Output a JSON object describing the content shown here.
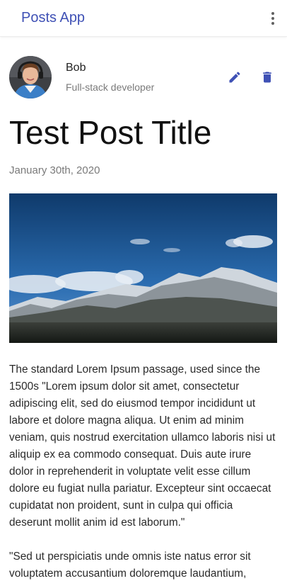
{
  "app": {
    "title": "Posts App",
    "menu_icon": "more-vert-icon"
  },
  "author": {
    "name": "Bob",
    "role": "Full-stack developer",
    "edit_icon": "pencil-icon",
    "delete_icon": "trash-icon"
  },
  "post": {
    "title": "Test Post Title",
    "date": "January 30th, 2020",
    "image_subject": "snow-covered mountains under blue sky",
    "paragraphs": [
      "The standard Lorem Ipsum passage, used since the 1500s \"Lorem ipsum dolor sit amet, consectetur adipiscing elit, sed do eiusmod tempor incididunt ut labore et dolore magna aliqua. Ut enim ad minim veniam, quis nostrud exercitation ullamco laboris nisi ut aliquip ex ea commodo consequat. Duis aute irure dolor in reprehenderit in voluptate velit esse cillum dolore eu fugiat nulla pariatur. Excepteur sint occaecat cupidatat non proident, sunt in culpa qui officia deserunt mollit anim id est laborum.\"",
      "\"Sed ut perspiciatis unde omnis iste natus error sit voluptatem accusantium doloremque laudantium,"
    ]
  },
  "colors": {
    "primary": "#3f51b5",
    "secondary_text": "#7a7a7a"
  }
}
